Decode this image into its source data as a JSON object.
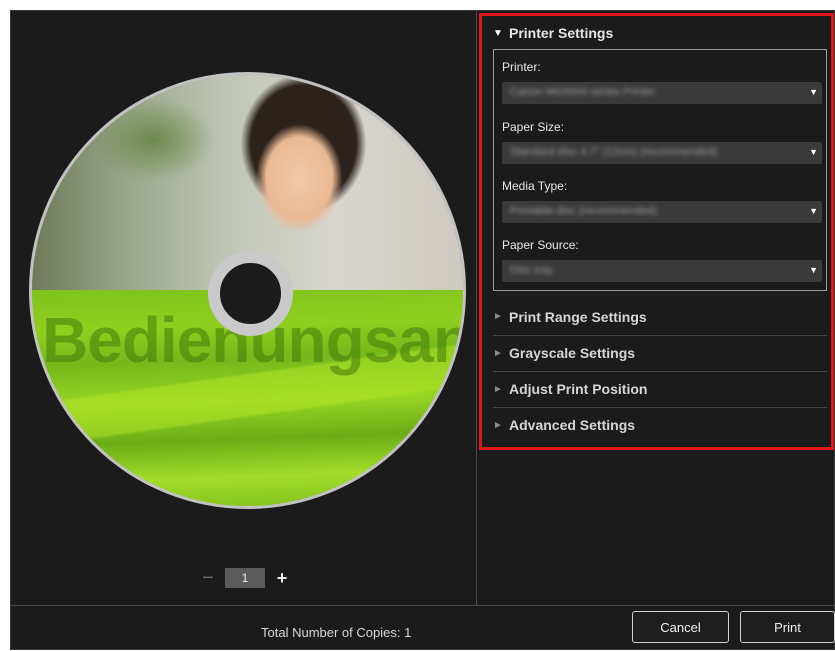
{
  "preview": {
    "disc_watermark": "Bedienungsan",
    "page_number": "1",
    "minus_symbol": "−",
    "plus_symbol": "+"
  },
  "settings": {
    "printer_settings": {
      "title": "Printer Settings",
      "expanded": true,
      "fields": [
        {
          "label": "Printer:",
          "value": "Canon MG5500 series Printer"
        },
        {
          "label": "Paper Size:",
          "value": "Standard disc 4.7\" (12cm) (recommended)"
        },
        {
          "label": "Media Type:",
          "value": "Printable disc (recommended)"
        },
        {
          "label": "Paper Source:",
          "value": "Disc tray"
        }
      ]
    },
    "collapsed_sections": [
      {
        "label": "Print Range Settings"
      },
      {
        "label": "Grayscale Settings"
      },
      {
        "label": "Adjust Print Position"
      },
      {
        "label": "Advanced Settings"
      }
    ],
    "highlight_color": "#e0161b"
  },
  "footer": {
    "total_copies_text": "Total Number of Copies:  1",
    "cancel_label": "Cancel",
    "print_label": "Print"
  },
  "icons": {
    "expanded": "caret-down-icon",
    "collapsed": "caret-right-icon",
    "dropdown": "dropdown-arrow-icon"
  }
}
